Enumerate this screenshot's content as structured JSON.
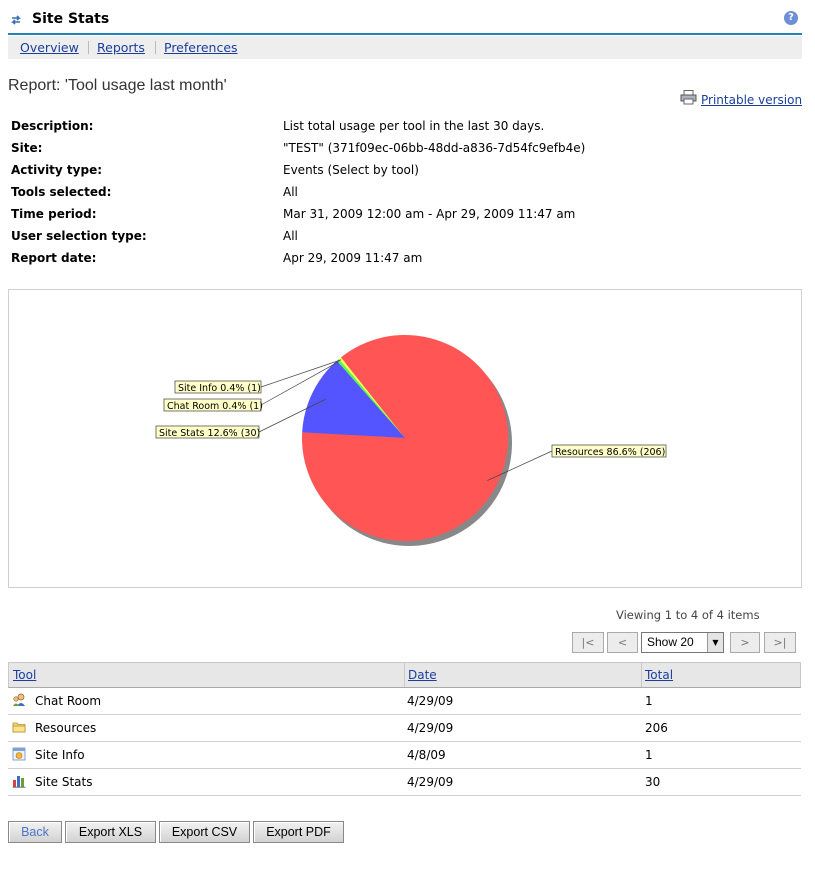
{
  "header": {
    "title": "Site Stats"
  },
  "nav": {
    "items": [
      "Overview",
      "Reports",
      "Preferences"
    ]
  },
  "report": {
    "heading": "Report: 'Tool usage last month'",
    "printable_label": "Printable version",
    "details": [
      {
        "label": "Description:",
        "value": "List total usage per tool in the last 30 days."
      },
      {
        "label": "Site:",
        "value": "\"TEST\" (371f09ec-06bb-48dd-a836-7d54fc9efb4e)"
      },
      {
        "label": "Activity type:",
        "value": "Events (Select by tool)"
      },
      {
        "label": "Tools selected:",
        "value": "All"
      },
      {
        "label": "Time period:",
        "value": "Mar 31, 2009 12:00 am - Apr 29, 2009 11:47 am"
      },
      {
        "label": "User selection type:",
        "value": "All"
      },
      {
        "label": "Report date:",
        "value": "Apr 29, 2009 11:47 am"
      }
    ]
  },
  "chart_data": {
    "type": "pie",
    "slices": [
      {
        "name": "Resources",
        "value": 206,
        "label": "Resources 86.6% (206)",
        "color": "#ff5555"
      },
      {
        "name": "Site Stats",
        "value": 30,
        "label": "Site Stats 12.6% (30)",
        "color": "#5555ff"
      },
      {
        "name": "Chat Room",
        "value": 1,
        "label": "Chat Room 0.4% (1)",
        "color": "#55ff55"
      },
      {
        "name": "Site Info",
        "value": 1,
        "label": "Site Info 0.4% (1)",
        "color": "#ffff55"
      }
    ]
  },
  "pager": {
    "viewing": "Viewing 1 to 4 of 4 items",
    "first": "|<",
    "prev": "<",
    "next": ">",
    "last": ">|",
    "page_size": "Show 20"
  },
  "table": {
    "columns": [
      "Tool",
      "Date",
      "Total"
    ],
    "rows": [
      {
        "icon": "chat-room-icon",
        "tool": "Chat Room",
        "date": "4/29/09",
        "total": "1"
      },
      {
        "icon": "resources-folder-icon",
        "tool": "Resources",
        "date": "4/29/09",
        "total": "206"
      },
      {
        "icon": "site-info-icon",
        "tool": "Site Info",
        "date": "4/8/09",
        "total": "1"
      },
      {
        "icon": "site-stats-icon",
        "tool": "Site Stats",
        "date": "4/29/09",
        "total": "30"
      }
    ]
  },
  "buttons": {
    "back": "Back",
    "export_xls": "Export XLS",
    "export_csv": "Export CSV",
    "export_pdf": "Export PDF"
  },
  "colors": {
    "accent": "#1e87b8",
    "link": "#1a3e9c"
  }
}
